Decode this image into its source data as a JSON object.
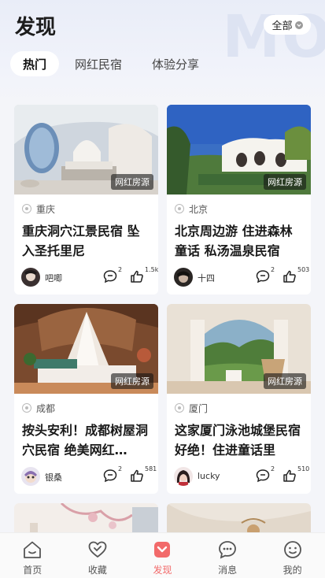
{
  "header": {
    "title": "发现",
    "filter_label": "全部",
    "watermark": "MO"
  },
  "tabs": [
    {
      "label": "热门",
      "active": true
    },
    {
      "label": "网红民宿",
      "active": false
    },
    {
      "label": "体验分享",
      "active": false
    }
  ],
  "cards": [
    {
      "badge": "网红房源",
      "location": "重庆",
      "title": "重庆洞穴江景民宿 坠入圣托里尼",
      "author": "吧唧",
      "comments": "2",
      "likes": "1.5k"
    },
    {
      "badge": "网红房源",
      "location": "北京",
      "title": "北京周边游 住进森林童话 私汤温泉民宿",
      "author": "十四",
      "comments": "2",
      "likes": "503"
    },
    {
      "badge": "网红房源",
      "location": "成都",
      "title": "按头安利！成都树屋洞穴民宿 绝美网红…",
      "author": "银桑",
      "comments": "2",
      "likes": "581"
    },
    {
      "badge": "网红房源",
      "location": "厦门",
      "title": "这家厦门泳池城堡民宿好绝！住进童话里",
      "author": "lucky",
      "comments": "2",
      "likes": "510"
    }
  ],
  "tabbar": [
    {
      "label": "首页",
      "icon": "home-icon",
      "active": false
    },
    {
      "label": "收藏",
      "icon": "heart-icon",
      "active": false
    },
    {
      "label": "发现",
      "icon": "discover-icon",
      "active": true
    },
    {
      "label": "消息",
      "icon": "message-icon",
      "active": false
    },
    {
      "label": "我的",
      "icon": "profile-icon",
      "active": false
    }
  ],
  "colors": {
    "accent": "#f26a6a",
    "background": "#f4f5f9"
  }
}
